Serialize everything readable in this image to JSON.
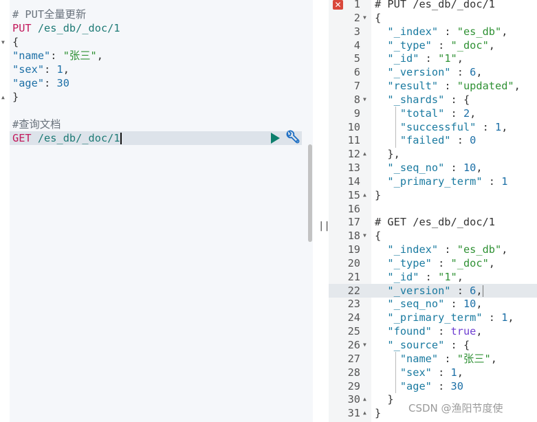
{
  "request_editor": {
    "lines": [
      [
        {
          "t": "c",
          "v": "# PUT全量更新"
        }
      ],
      [
        {
          "t": "m",
          "v": "PUT"
        },
        {
          "t": "u",
          "v": " /es_db/_doc/1"
        }
      ],
      [
        {
          "t": "p",
          "v": "{"
        }
      ],
      [
        {
          "t": "k",
          "v": "\"name\""
        },
        {
          "t": "p",
          "v": ": "
        },
        {
          "t": "s",
          "v": "\"张三\""
        },
        {
          "t": "p",
          "v": ","
        }
      ],
      [
        {
          "t": "k",
          "v": "\"sex\""
        },
        {
          "t": "p",
          "v": ": "
        },
        {
          "t": "n",
          "v": "1"
        },
        {
          "t": "p",
          "v": ","
        }
      ],
      [
        {
          "t": "k",
          "v": "\"age\""
        },
        {
          "t": "p",
          "v": ": "
        },
        {
          "t": "n",
          "v": "30"
        }
      ],
      [
        {
          "t": "p",
          "v": "}"
        }
      ],
      [],
      [
        {
          "t": "c",
          "v": "#查询文档"
        }
      ],
      [
        {
          "t": "m",
          "v": "GET"
        },
        {
          "t": "u",
          "v": " /es_db/_doc/1"
        }
      ]
    ],
    "run_icon": "play-icon",
    "settings_icon": "wrench-icon"
  },
  "divider_label": "||",
  "response": {
    "error_icon": "close-icon",
    "highlighted_line": 22,
    "lines": [
      [
        {
          "t": "rc",
          "v": "# PUT /es_db/_doc/1"
        }
      ],
      [
        {
          "t": "p",
          "v": "{"
        }
      ],
      [
        {
          "t": "rk",
          "v": "  \"_index\""
        },
        {
          "t": "p",
          "v": " : "
        },
        {
          "t": "s",
          "v": "\"es_db\""
        },
        {
          "t": "p",
          "v": ","
        }
      ],
      [
        {
          "t": "rk",
          "v": "  \"_type\""
        },
        {
          "t": "p",
          "v": " : "
        },
        {
          "t": "s",
          "v": "\"_doc\""
        },
        {
          "t": "p",
          "v": ","
        }
      ],
      [
        {
          "t": "rk",
          "v": "  \"_id\""
        },
        {
          "t": "p",
          "v": " : "
        },
        {
          "t": "s",
          "v": "\"1\""
        },
        {
          "t": "p",
          "v": ","
        }
      ],
      [
        {
          "t": "rk",
          "v": "  \"_version\""
        },
        {
          "t": "p",
          "v": " : "
        },
        {
          "t": "n",
          "v": "6"
        },
        {
          "t": "p",
          "v": ","
        }
      ],
      [
        {
          "t": "rk",
          "v": "  \"result\""
        },
        {
          "t": "p",
          "v": " : "
        },
        {
          "t": "s",
          "v": "\"updated\""
        },
        {
          "t": "p",
          "v": ","
        }
      ],
      [
        {
          "t": "rk",
          "v": "  \"_shards\""
        },
        {
          "t": "p",
          "v": " : {"
        }
      ],
      [
        {
          "t": "rk",
          "v": "    \"total\""
        },
        {
          "t": "p",
          "v": " : "
        },
        {
          "t": "n",
          "v": "2"
        },
        {
          "t": "p",
          "v": ","
        }
      ],
      [
        {
          "t": "rk",
          "v": "    \"successful\""
        },
        {
          "t": "p",
          "v": " : "
        },
        {
          "t": "n",
          "v": "1"
        },
        {
          "t": "p",
          "v": ","
        }
      ],
      [
        {
          "t": "rk",
          "v": "    \"failed\""
        },
        {
          "t": "p",
          "v": " : "
        },
        {
          "t": "n",
          "v": "0"
        }
      ],
      [
        {
          "t": "p",
          "v": "  },"
        }
      ],
      [
        {
          "t": "rk",
          "v": "  \"_seq_no\""
        },
        {
          "t": "p",
          "v": " : "
        },
        {
          "t": "n",
          "v": "10"
        },
        {
          "t": "p",
          "v": ","
        }
      ],
      [
        {
          "t": "rk",
          "v": "  \"_primary_term\""
        },
        {
          "t": "p",
          "v": " : "
        },
        {
          "t": "n",
          "v": "1"
        }
      ],
      [
        {
          "t": "p",
          "v": "}"
        }
      ],
      [],
      [
        {
          "t": "rc",
          "v": "# GET /es_db/_doc/1"
        }
      ],
      [
        {
          "t": "p",
          "v": "{"
        }
      ],
      [
        {
          "t": "rk",
          "v": "  \"_index\""
        },
        {
          "t": "p",
          "v": " : "
        },
        {
          "t": "s",
          "v": "\"es_db\""
        },
        {
          "t": "p",
          "v": ","
        }
      ],
      [
        {
          "t": "rk",
          "v": "  \"_type\""
        },
        {
          "t": "p",
          "v": " : "
        },
        {
          "t": "s",
          "v": "\"_doc\""
        },
        {
          "t": "p",
          "v": ","
        }
      ],
      [
        {
          "t": "rk",
          "v": "  \"_id\""
        },
        {
          "t": "p",
          "v": " : "
        },
        {
          "t": "s",
          "v": "\"1\""
        },
        {
          "t": "p",
          "v": ","
        }
      ],
      [
        {
          "t": "rk",
          "v": "  \"_version\""
        },
        {
          "t": "p",
          "v": " : "
        },
        {
          "t": "n",
          "v": "6"
        },
        {
          "t": "p",
          "v": ","
        }
      ],
      [
        {
          "t": "rk",
          "v": "  \"_seq_no\""
        },
        {
          "t": "p",
          "v": " : "
        },
        {
          "t": "n",
          "v": "10"
        },
        {
          "t": "p",
          "v": ","
        }
      ],
      [
        {
          "t": "rk",
          "v": "  \"_primary_term\""
        },
        {
          "t": "p",
          "v": " : "
        },
        {
          "t": "n",
          "v": "1"
        },
        {
          "t": "p",
          "v": ","
        }
      ],
      [
        {
          "t": "rk",
          "v": "  \"found\""
        },
        {
          "t": "p",
          "v": " : "
        },
        {
          "t": "b",
          "v": "true"
        },
        {
          "t": "p",
          "v": ","
        }
      ],
      [
        {
          "t": "rk",
          "v": "  \"_source\""
        },
        {
          "t": "p",
          "v": " : {"
        }
      ],
      [
        {
          "t": "rk",
          "v": "    \"name\""
        },
        {
          "t": "p",
          "v": " : "
        },
        {
          "t": "s",
          "v": "\"张三\""
        },
        {
          "t": "p",
          "v": ","
        }
      ],
      [
        {
          "t": "rk",
          "v": "    \"sex\""
        },
        {
          "t": "p",
          "v": " : "
        },
        {
          "t": "n",
          "v": "1"
        },
        {
          "t": "p",
          "v": ","
        }
      ],
      [
        {
          "t": "rk",
          "v": "    \"age\""
        },
        {
          "t": "p",
          "v": " : "
        },
        {
          "t": "n",
          "v": "30"
        }
      ],
      [
        {
          "t": "p",
          "v": "  }"
        }
      ],
      [
        {
          "t": "p",
          "v": "}"
        }
      ]
    ],
    "fold_open": [
      2,
      8,
      18,
      26
    ],
    "fold_close": [
      12,
      15,
      30,
      31
    ]
  },
  "watermark": "CSDN @渔阳节度使",
  "colors": {
    "method": "#c2185b",
    "key": "#1c6fa6",
    "string": "#2f9134",
    "run": "#0e7f6d",
    "error": "#d9483b"
  }
}
